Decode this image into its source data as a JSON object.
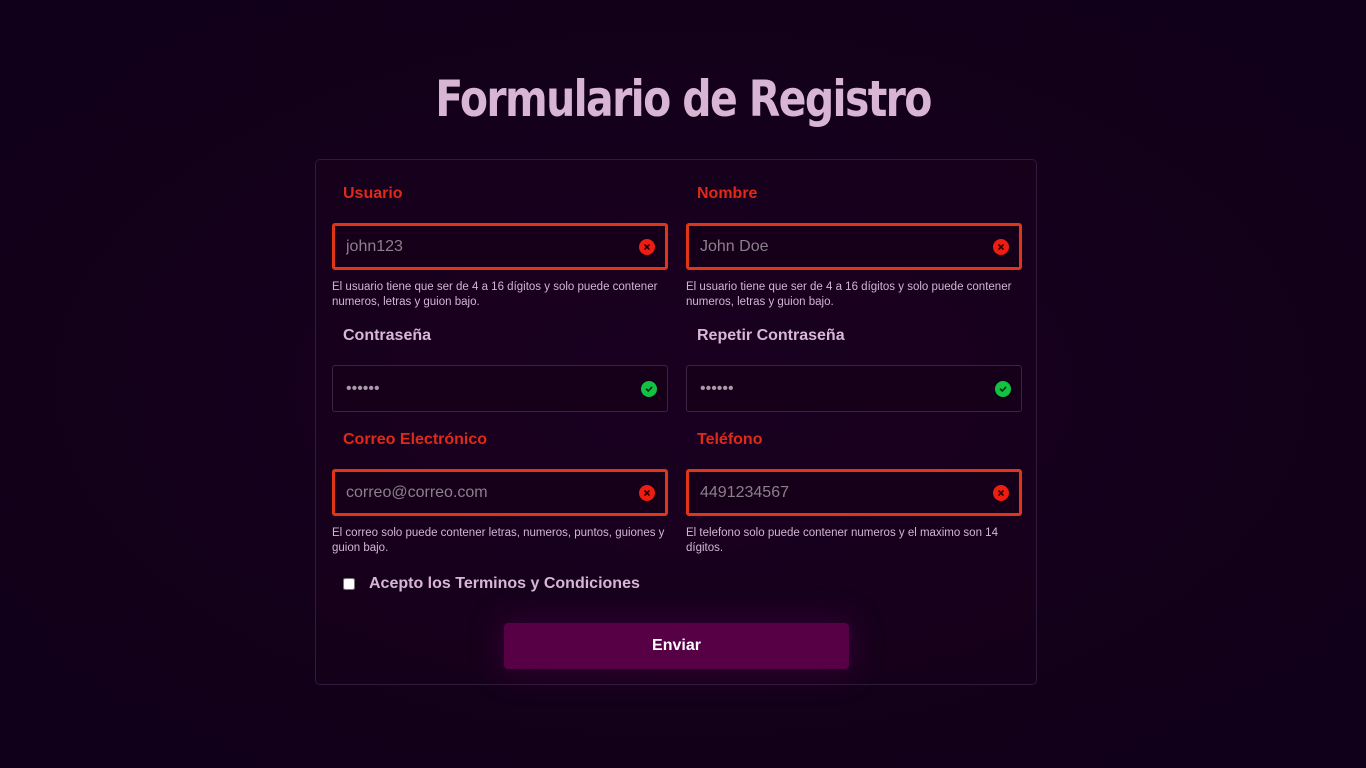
{
  "page": {
    "title": "Formulario de Registro"
  },
  "form": {
    "fields": {
      "usuario": {
        "label": "Usuario",
        "placeholder": "john123",
        "value": "",
        "status": "error",
        "error": "El usuario tiene que ser de 4 a 16 dígitos y solo puede contener numeros, letras y guion bajo."
      },
      "nombre": {
        "label": "Nombre",
        "placeholder": "John Doe",
        "value": "",
        "status": "error",
        "error": "El usuario tiene que ser de 4 a 16 dígitos y solo puede contener numeros, letras y guion bajo."
      },
      "password": {
        "label": "Contraseña",
        "value": "••••••",
        "status": "ok"
      },
      "password2": {
        "label": "Repetir Contraseña",
        "value": "••••••",
        "status": "ok"
      },
      "correo": {
        "label": "Correo Electrónico",
        "placeholder": "correo@correo.com",
        "value": "",
        "status": "error",
        "error": "El correo solo puede contener letras, numeros, puntos, guiones y guion bajo."
      },
      "telefono": {
        "label": "Teléfono",
        "placeholder": "4491234567",
        "value": "",
        "status": "error",
        "error": "El telefono solo puede contener numeros y el maximo son 14 dígitos."
      }
    },
    "terms": {
      "label": "Acepto los Terminos y Condiciones",
      "checked": false
    },
    "submit_label": "Enviar"
  },
  "icons": {
    "error": "error-circle-icon",
    "ok": "check-circle-icon"
  },
  "colors": {
    "background": "#130019",
    "error": "#e02917",
    "success": "#12c243",
    "button": "#570046",
    "title": "#d7b5d3"
  }
}
